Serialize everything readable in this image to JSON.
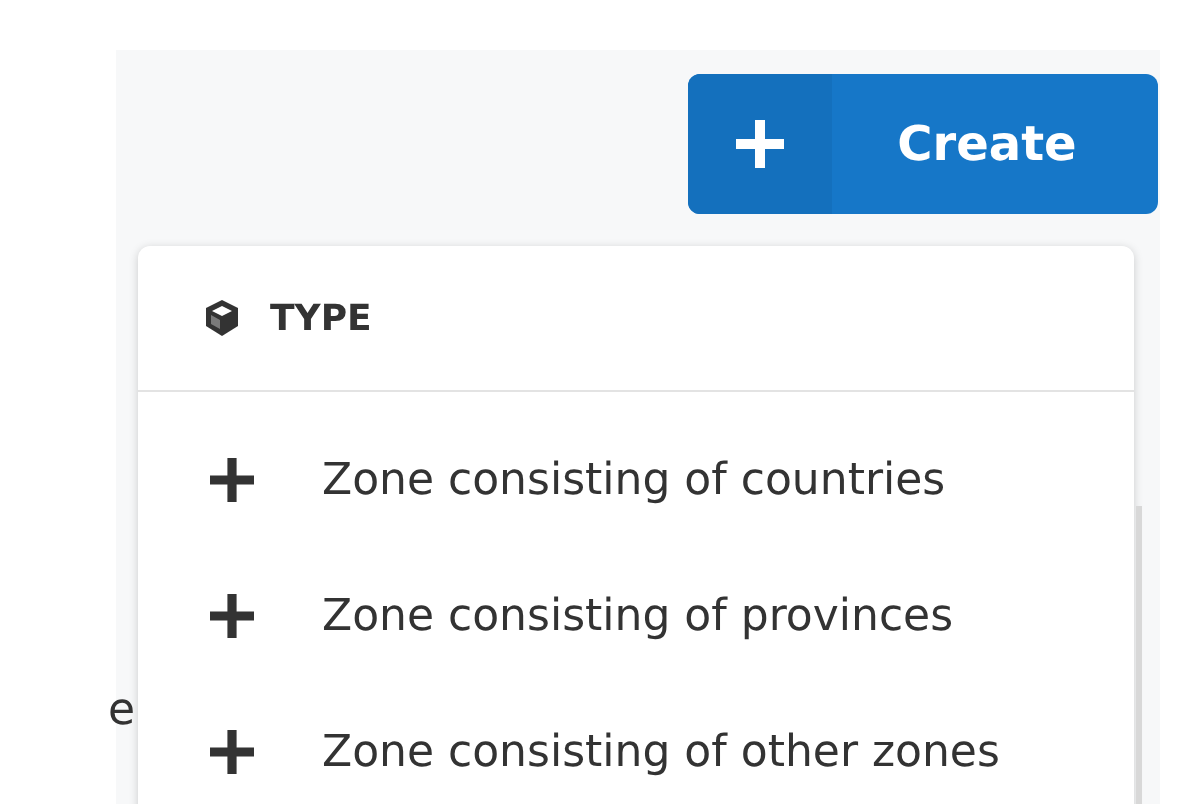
{
  "create_button": {
    "label": "Create"
  },
  "type_menu": {
    "header": "TYPE",
    "items": [
      {
        "label": "Zone consisting of countries"
      },
      {
        "label": "Zone consisting of provinces"
      },
      {
        "label": "Zone consisting of other zones"
      }
    ]
  },
  "background_text": "e"
}
